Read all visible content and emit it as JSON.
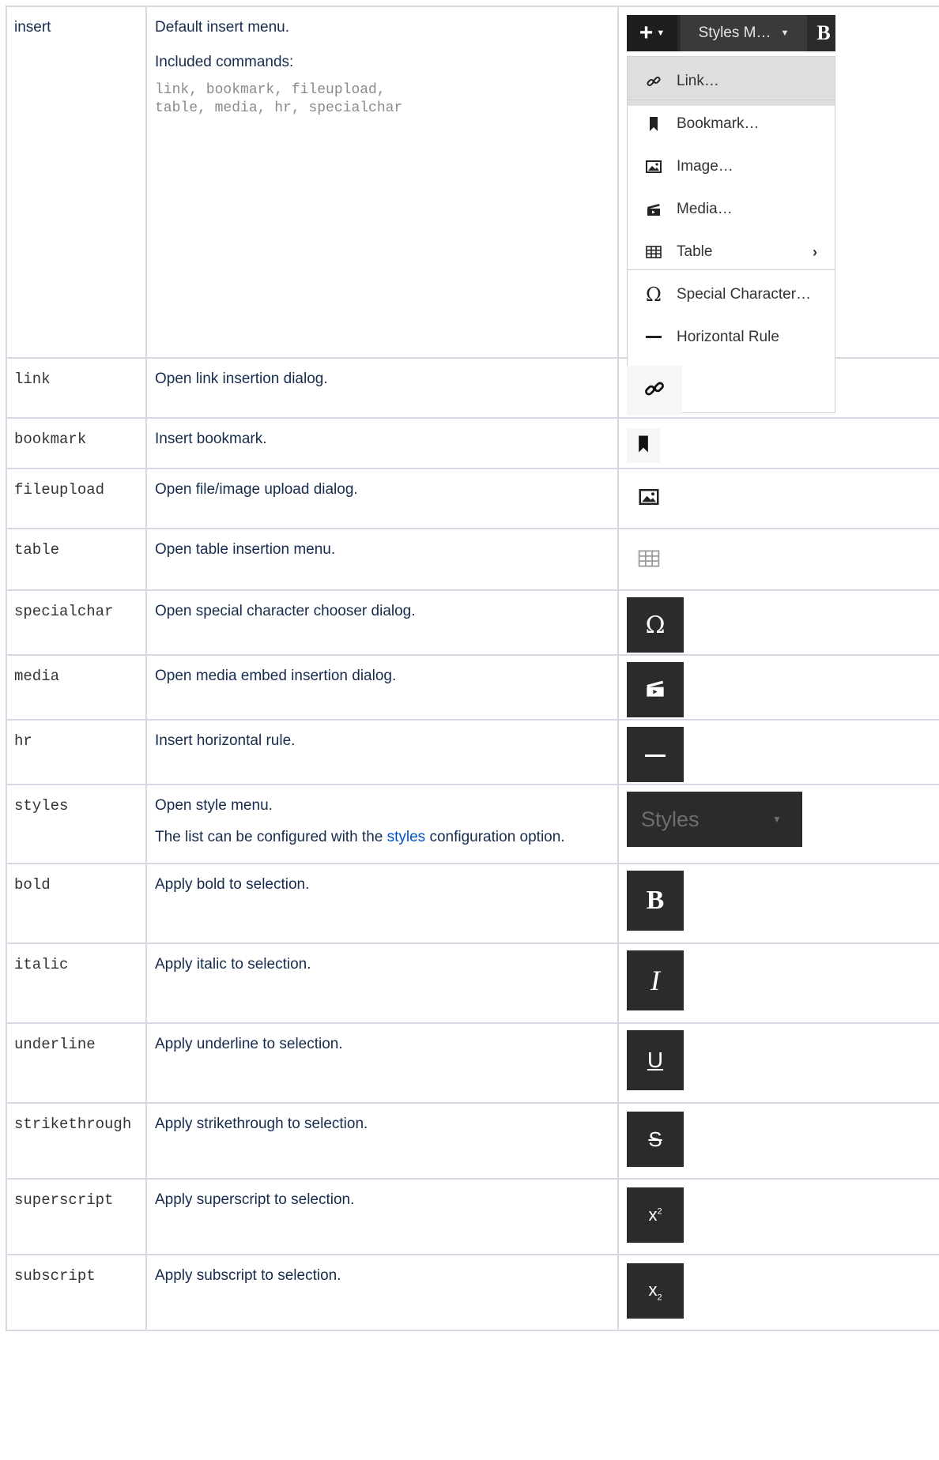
{
  "insert_menu": {
    "toolbar_plus": "+",
    "toolbar_styles": "Styles M…",
    "toolbar_bold": "B",
    "items": [
      {
        "label": "Link…",
        "icon": "link-icon"
      },
      {
        "label": "Bookmark…",
        "icon": "bookmark-icon"
      },
      {
        "label": "Image…",
        "icon": "image-icon"
      },
      {
        "label": "Media…",
        "icon": "media-icon"
      },
      {
        "label": "Table",
        "icon": "table-icon"
      },
      {
        "label": "Special Character…",
        "icon": "omega-icon"
      },
      {
        "label": "Horizontal Rule",
        "icon": "horizontal-rule-icon"
      }
    ]
  },
  "rows": [
    {
      "name": "insert",
      "desc": "Default insert menu.",
      "extra": "Included commands:",
      "code": "link, bookmark, fileupload,\ntable, media, hr, specialchar"
    },
    {
      "name": "link",
      "desc": "Open link insertion dialog."
    },
    {
      "name": "bookmark",
      "desc": "Insert bookmark."
    },
    {
      "name": "fileupload",
      "desc": "Open file/image upload dialog."
    },
    {
      "name": "table",
      "desc": "Open table insertion menu."
    },
    {
      "name": "specialchar",
      "desc": "Open special character chooser dialog.",
      "glyph": "Ω"
    },
    {
      "name": "media",
      "desc": "Open media embed insertion dialog."
    },
    {
      "name": "hr",
      "desc": "Insert horizontal rule."
    },
    {
      "name": "styles",
      "desc": "Open style menu.",
      "extra_before": "The list can be configured with the ",
      "link": "styles",
      "extra_after": " configuration option.",
      "preview_label": "Styles"
    },
    {
      "name": "bold",
      "desc": "Apply bold to selection.",
      "glyph": "B"
    },
    {
      "name": "italic",
      "desc": "Apply italic to selection.",
      "glyph": "I"
    },
    {
      "name": "underline",
      "desc": "Apply underline to selection.",
      "glyph": "U"
    },
    {
      "name": "strikethrough",
      "desc": "Apply strikethrough to selection.",
      "glyph": "S"
    },
    {
      "name": "superscript",
      "desc": "Apply superscript to selection.",
      "glyph": "x",
      "sup": "2"
    },
    {
      "name": "subscript",
      "desc": "Apply subscript to selection.",
      "glyph": "x",
      "sub": "2"
    }
  ]
}
